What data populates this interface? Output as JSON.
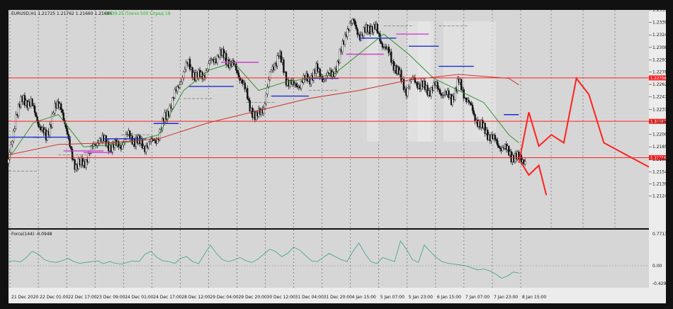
{
  "header": {
    "symbol_info": "EURUSD,H1  1.21725 1.21762 1.21660 1.21686",
    "indicator_info": "00:39:25 Плечо 500 Спред 18"
  },
  "chart_data": [
    {
      "type": "line",
      "title": "EURUSD,H1",
      "ylim": [
        1.2084,
        1.2355
      ],
      "yticks": [
        "1.23550",
        "1.23395",
        "1.23240",
        "1.23085",
        "1.22930",
        "1.22780",
        "1.22625",
        "1.22470",
        "1.22315",
        "1.22160",
        "1.22005",
        "1.21850",
        "1.21695",
        "1.21540",
        "1.21390",
        "1.21240"
      ],
      "xticks": [
        "21 Dec 2020",
        "22 Dec 01:00",
        "22 Dec 17:00",
        "23 Dec 09:00",
        "24 Dec 01:00",
        "24 Dec 17:00",
        "28 Dec 12:00",
        "29 Dec 04:00",
        "29 Dec 20:00",
        "30 Dec 12:00",
        "31 Dec 04:00",
        "31 Dec 20:00",
        "4 Jan 15:00",
        "5 Jan 07:00",
        "5 Jan 23:00",
        "6 Jan 15:00",
        "7 Jan 07:00",
        "7 Jan 23:00",
        "8 Jan 15:00"
      ],
      "horizontal_lines": [
        {
          "price": 1.22706,
          "label": "1.22706",
          "color": "#ff2020"
        },
        {
          "price": 1.22167,
          "label": "1.22167",
          "color": "#ff2020"
        },
        {
          "price": 1.21716,
          "label": "1.21716",
          "color": "#ff2020"
        }
      ],
      "series": [
        {
          "type": "close",
          "x": [
            0,
            3,
            6,
            9,
            12,
            15,
            18,
            21,
            24,
            27,
            30,
            33,
            36,
            39,
            42,
            45,
            48,
            51,
            54,
            57,
            60,
            63,
            66,
            69,
            72,
            75,
            78,
            81,
            84,
            87,
            90,
            93,
            96,
            99,
            102,
            105,
            108,
            111,
            114,
            117,
            120,
            123,
            126,
            129,
            132,
            135,
            138,
            141,
            144,
            147,
            150,
            153,
            156,
            159,
            162,
            165,
            168,
            171,
            174,
            177,
            180,
            183,
            186,
            189,
            192,
            195,
            198,
            201,
            204
          ],
          "values": [
            1.2165,
            1.2225,
            1.2245,
            1.2238,
            1.2215,
            1.2195,
            1.223,
            1.2238,
            1.219,
            1.216,
            1.2165,
            1.218,
            1.2195,
            1.219,
            1.2185,
            1.2188,
            1.22,
            1.2192,
            1.2186,
            1.219,
            1.2198,
            1.2225,
            1.2245,
            1.227,
            1.229,
            1.227,
            1.2275,
            1.229,
            1.23,
            1.2295,
            1.2285,
            1.227,
            1.224,
            1.222,
            1.2235,
            1.228,
            1.23,
            1.227,
            1.226,
            1.2265,
            1.227,
            1.228,
            1.227,
            1.2275,
            1.229,
            1.233,
            1.234,
            1.232,
            1.2335,
            1.233,
            1.231,
            1.2295,
            1.2275,
            1.2255,
            1.227,
            1.226,
            1.2255,
            1.226,
            1.225,
            1.2245,
            1.2265,
            1.2245,
            1.2225,
            1.221,
            1.22,
            1.219,
            1.2183,
            1.2175,
            1.217
          ]
        },
        {
          "type": "ma_fast",
          "color": "#2a8a2a",
          "x": [
            0,
            10,
            20,
            30,
            40,
            50,
            60,
            70,
            80,
            90,
            100,
            110,
            120,
            130,
            140,
            150,
            160,
            170,
            180,
            190,
            200,
            204
          ],
          "values": [
            1.217,
            1.2215,
            1.2225,
            1.2185,
            1.2187,
            1.2192,
            1.22,
            1.2255,
            1.228,
            1.229,
            1.2255,
            1.2265,
            1.227,
            1.2275,
            1.23,
            1.2325,
            1.23,
            1.227,
            1.2255,
            1.224,
            1.22,
            1.219
          ]
        },
        {
          "type": "ma_slow",
          "color": "#d02020",
          "x": [
            0,
            20,
            40,
            60,
            80,
            100,
            120,
            140,
            160,
            180,
            200,
            204
          ],
          "values": [
            1.2175,
            1.2188,
            1.219,
            1.2195,
            1.2215,
            1.223,
            1.2245,
            1.2255,
            1.2268,
            1.2275,
            1.227,
            1.2262
          ]
        },
        {
          "type": "forecast",
          "color": "#ff2020",
          "x": [
            204,
            208,
            212,
            217,
            222,
            227,
            232,
            238,
            244,
            250,
            256
          ],
          "values": [
            1.2165,
            1.2228,
            1.2186,
            1.22,
            1.219,
            1.227,
            1.225,
            1.219,
            1.218,
            1.217,
            1.216
          ]
        }
      ]
    },
    {
      "type": "line",
      "title": "Force(144) -0.0948",
      "yticks": [
        "0.7713",
        "0.00",
        "-0.4295"
      ],
      "ylim": [
        -0.4295,
        0.7713
      ],
      "series": [
        {
          "type": "force",
          "color": "#3aa08a",
          "values": [
            0.1,
            0.12,
            0.09,
            0.2,
            0.35,
            0.28,
            0.15,
            0.1,
            0.08,
            0.12,
            0.18,
            0.1,
            0.06,
            0.08,
            0.1,
            0.12,
            0.05,
            0.1,
            0.06,
            0.04,
            0.08,
            0.12,
            0.1,
            0.28,
            0.35,
            0.2,
            0.12,
            0.1,
            0.06,
            0.18,
            0.22,
            0.1,
            0.05,
            0.28,
            0.5,
            0.3,
            0.15,
            0.1,
            0.14,
            0.2,
            0.12,
            0.08,
            0.16,
            0.28,
            0.4,
            0.34,
            0.22,
            0.3,
            0.45,
            0.38,
            0.25,
            0.12,
            0.1,
            0.2,
            0.3,
            0.22,
            0.15,
            0.1,
            0.35,
            0.55,
            0.3,
            0.1,
            0.05,
            0.2,
            0.15,
            0.1,
            0.6,
            0.4,
            0.15,
            0.08,
            0.5,
            0.35,
            0.2,
            0.1,
            0.06,
            0.04,
            0.02,
            0.0,
            -0.05,
            -0.1,
            -0.08,
            -0.12,
            -0.2,
            -0.3,
            -0.25,
            -0.15,
            -0.18
          ]
        }
      ]
    }
  ]
}
